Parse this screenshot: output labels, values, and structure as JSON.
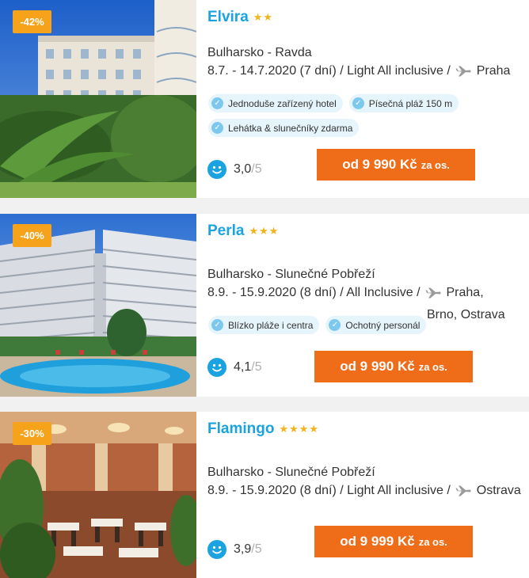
{
  "hotels": [
    {
      "discount": "-42%",
      "name": "Elvira",
      "stars": "★★",
      "location": "Bulharsko - Ravda",
      "trip": "8.7. - 14.7.2020 (7 dní) / Light All inclusive /",
      "departure": "Praha",
      "departure_extra": "",
      "tags": [
        "Jednoduše zařízený hotel",
        "Písečná pláž 150 m",
        "Lehátka & slunečníky zdarma"
      ],
      "rating": "3,0",
      "rating_max": "/5",
      "price": "od 9 990 Kč",
      "price_unit": "za os."
    },
    {
      "discount": "-40%",
      "name": "Perla",
      "stars": "★★★",
      "location": "Bulharsko - Slunečné Pobřeží",
      "trip": "8.9. - 15.9.2020 (8 dní) / All Inclusive /",
      "departure": "Praha,",
      "departure_extra": "Brno, Ostrava",
      "tags": [
        "Blízko pláže i centra",
        "Ochotný personál"
      ],
      "rating": "4,1",
      "rating_max": "/5",
      "price": "od 9 990 Kč",
      "price_unit": "za os."
    },
    {
      "discount": "-30%",
      "name": "Flamingo",
      "stars": "★★★★",
      "location": "Bulharsko - Slunečné Pobřeží",
      "trip": "8.9. - 15.9.2020 (8 dní) / Light All inclusive /",
      "departure": "Ostrava",
      "departure_extra": "",
      "tags": [],
      "rating": "3,9",
      "rating_max": "/5",
      "price": "od 9 999 Kč",
      "price_unit": "za os."
    }
  ],
  "icons": {
    "check": "check-icon",
    "plane": "plane-icon",
    "rating": "smiley-icon"
  },
  "colors": {
    "title": "#1aa3e0",
    "discount": "#f7a21b",
    "price_button": "#ef6c19",
    "stars": "#f2b31b",
    "tag_bg": "#e6f4fb"
  }
}
